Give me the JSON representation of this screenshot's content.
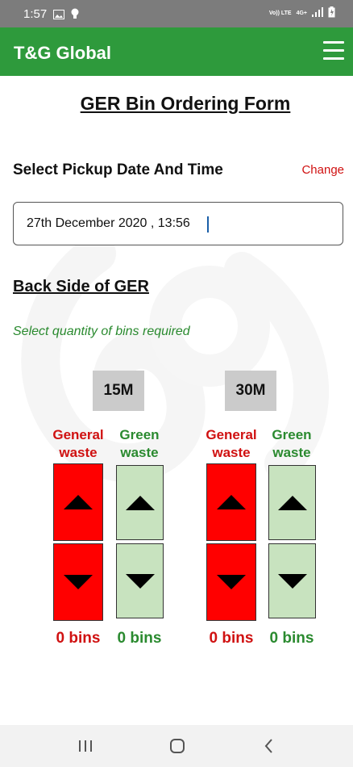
{
  "status_bar": {
    "time": "1:57",
    "network_label": "Vo)) LTE",
    "signal_label": "4G+"
  },
  "app_bar": {
    "title": "T&G Global"
  },
  "form": {
    "title": "GER Bin Ordering Form",
    "pickup_label": "Select Pickup Date And Time",
    "change_label": "Change",
    "datetime_value": "27th December 2020 , 13:56",
    "section_heading": "Back Side of GER",
    "quantity_hint": "Select quantity of bins required"
  },
  "bin_groups": [
    {
      "size": "15M",
      "general_label_line1": "General",
      "general_label_line2": "waste",
      "green_label_line1": "Green",
      "green_label_line2": "waste",
      "general_count": "0 bins",
      "green_count": "0 bins"
    },
    {
      "size": "30M",
      "general_label_line1": "General",
      "general_label_line2": "waste",
      "green_label_line1": "Green",
      "green_label_line2": "waste",
      "general_count": "0 bins",
      "green_count": "0 bins"
    }
  ],
  "colors": {
    "app_bar": "#2e9a3c",
    "general_waste": "#d01111",
    "green_waste": "#2a8a2f",
    "general_button": "#ff0000",
    "green_button": "#c8e3bf"
  }
}
